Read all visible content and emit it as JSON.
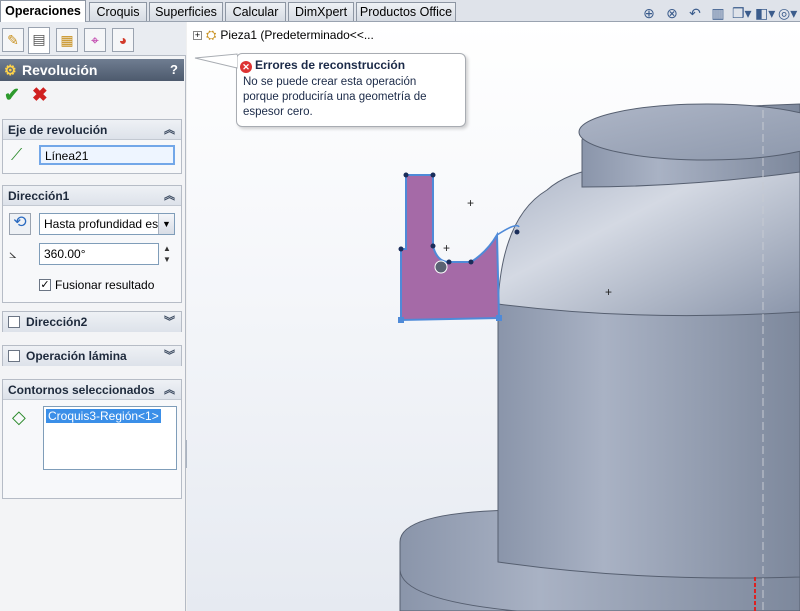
{
  "command_tabs": [
    "Operaciones",
    "Croquis",
    "Superficies",
    "Calcular",
    "DimXpert",
    "Productos Office"
  ],
  "toolbar_icons": [
    "zoom-to-fit-icon",
    "zoom-area-icon",
    "previous-view-icon",
    "section-view-icon",
    "view-orientation-icon",
    "display-style-icon",
    "hide-show-icon"
  ],
  "property_manager": {
    "tabs": [
      "feature-manager-icon",
      "property-manager-icon",
      "configuration-manager-icon",
      "dimxpert-manager-icon",
      "display-manager-icon"
    ],
    "title": "Revolución",
    "help": "?",
    "ok_icon": "✔",
    "cancel_icon": "✖",
    "axis_group": {
      "title": "Eje de revolución",
      "value": "Línea21"
    },
    "direction1": {
      "title": "Dirección1",
      "end_condition": "Hasta profundidad espe",
      "angle": "360.00°",
      "merge_label": "Fusionar resultado",
      "merge_checked": true
    },
    "direction2": {
      "title": "Dirección2",
      "checked": false
    },
    "thin_feature": {
      "title": "Operación lámina",
      "checked": false
    },
    "contours": {
      "title": "Contornos seleccionados",
      "item": "Croquis3-Región<1>"
    }
  },
  "viewport": {
    "tree_label": "Pieza1  (Predeterminado<<...",
    "error": {
      "title": "Errores de reconstrucción",
      "message_lines": [
        "No se puede crear esta operación",
        "porque produciría una geometría de",
        "espesor cero."
      ]
    }
  },
  "colors": {
    "header": "#4d5a6d",
    "selection": "#3b8fe8",
    "sketch_region": "#a56aa7",
    "model": "#8e9bb0"
  }
}
